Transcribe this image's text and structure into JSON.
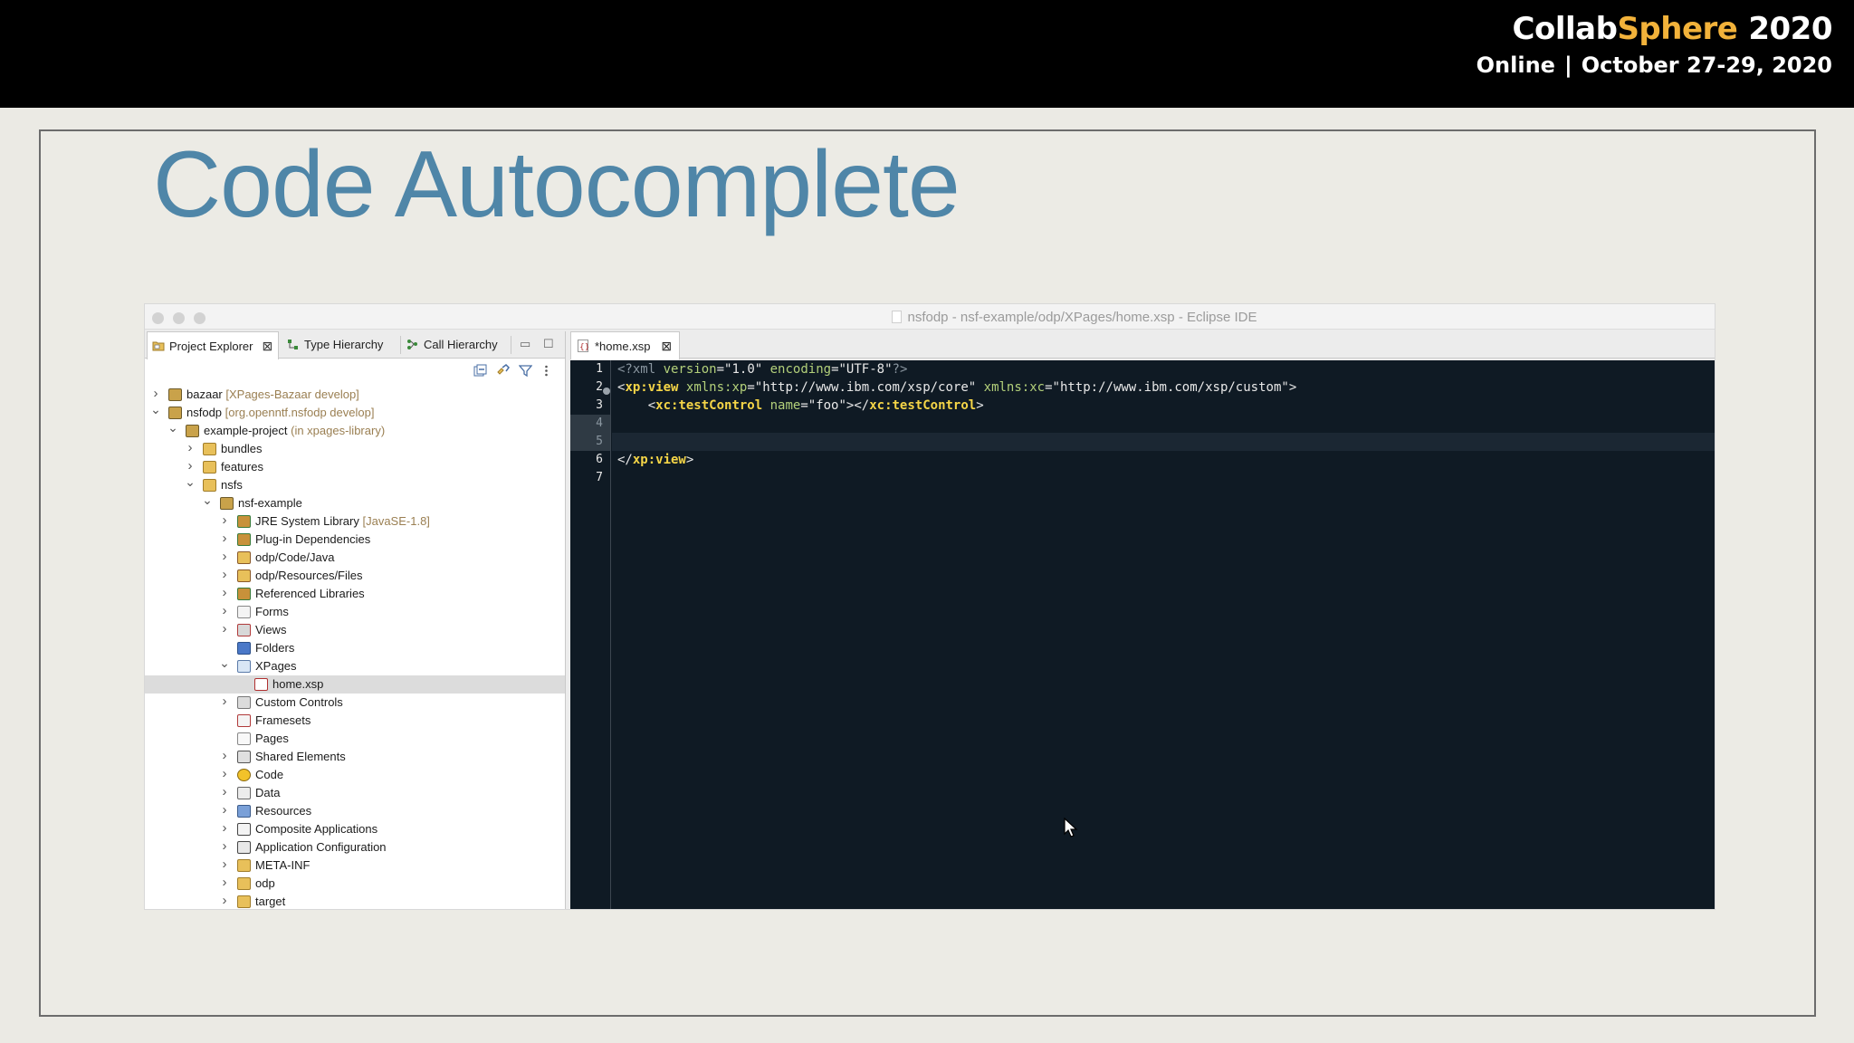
{
  "brand": {
    "collab": "Collab",
    "sphere": "Sphere",
    "year": "2020",
    "online": "Online",
    "separator": "|",
    "dates": "October 27-29, 2020"
  },
  "slide": {
    "title": "Code Autocomplete"
  },
  "window": {
    "title": "nsfodp - nsf-example/odp/XPages/home.xsp - Eclipse IDE"
  },
  "left_view": {
    "tabs": [
      {
        "label": "Project Explorer",
        "icon": "project-explorer-icon"
      },
      {
        "label": "Type Hierarchy",
        "icon": "type-hierarchy-icon"
      },
      {
        "label": "Call Hierarchy",
        "icon": "call-hierarchy-icon"
      }
    ],
    "toolbar": [
      "collapse-all-icon",
      "link-editor-icon",
      "filter-icon",
      "view-menu-icon"
    ],
    "tree": [
      {
        "label": "bazaar",
        "deco": "[XPages-Bazaar develop]",
        "level": 0,
        "expanded": false,
        "icon": "project-icon"
      },
      {
        "label": "nsfodp",
        "deco": "[org.openntf.nsfodp develop]",
        "level": 0,
        "expanded": true,
        "icon": "project-icon"
      },
      {
        "label": "example-project",
        "deco": "(in xpages-library)",
        "level": 1,
        "expanded": true,
        "icon": "project-icon"
      },
      {
        "label": "bundles",
        "deco": "",
        "level": 2,
        "expanded": false,
        "icon": "folder-icon"
      },
      {
        "label": "features",
        "deco": "",
        "level": 2,
        "expanded": false,
        "icon": "folder-icon"
      },
      {
        "label": "nsfs",
        "deco": "",
        "level": 2,
        "expanded": true,
        "icon": "folder-icon"
      },
      {
        "label": "nsf-example",
        "deco": "",
        "level": 3,
        "expanded": true,
        "icon": "project-icon"
      },
      {
        "label": "JRE System Library",
        "deco": "[JavaSE-1.8]",
        "level": 4,
        "expanded": false,
        "icon": "library-icon"
      },
      {
        "label": "Plug-in Dependencies",
        "deco": "",
        "level": 4,
        "expanded": false,
        "icon": "library-icon"
      },
      {
        "label": "odp/Code/Java",
        "deco": "",
        "level": 4,
        "expanded": false,
        "icon": "source-folder-icon"
      },
      {
        "label": "odp/Resources/Files",
        "deco": "",
        "level": 4,
        "expanded": false,
        "icon": "source-folder-icon"
      },
      {
        "label": "Referenced Libraries",
        "deco": "",
        "level": 4,
        "expanded": false,
        "icon": "library-icon"
      },
      {
        "label": "Forms",
        "deco": "",
        "level": 4,
        "expanded": false,
        "icon": "forms-icon"
      },
      {
        "label": "Views",
        "deco": "",
        "level": 4,
        "expanded": false,
        "icon": "views-icon"
      },
      {
        "label": "Folders",
        "deco": "",
        "level": 4,
        "expanded": null,
        "icon": "folders-icon"
      },
      {
        "label": "XPages",
        "deco": "",
        "level": 4,
        "expanded": true,
        "icon": "xpages-icon"
      },
      {
        "label": "home.xsp",
        "deco": "",
        "level": 5,
        "expanded": null,
        "icon": "xsp-file-icon",
        "selected": true
      },
      {
        "label": "Custom Controls",
        "deco": "",
        "level": 4,
        "expanded": false,
        "icon": "custom-controls-icon"
      },
      {
        "label": "Framesets",
        "deco": "",
        "level": 4,
        "expanded": null,
        "icon": "framesets-icon"
      },
      {
        "label": "Pages",
        "deco": "",
        "level": 4,
        "expanded": null,
        "icon": "pages-icon"
      },
      {
        "label": "Shared Elements",
        "deco": "",
        "level": 4,
        "expanded": false,
        "icon": "shared-elements-icon"
      },
      {
        "label": "Code",
        "deco": "",
        "level": 4,
        "expanded": false,
        "icon": "code-icon"
      },
      {
        "label": "Data",
        "deco": "",
        "level": 4,
        "expanded": false,
        "icon": "data-icon"
      },
      {
        "label": "Resources",
        "deco": "",
        "level": 4,
        "expanded": false,
        "icon": "resources-icon"
      },
      {
        "label": "Composite Applications",
        "deco": "",
        "level": 4,
        "expanded": false,
        "icon": "composite-apps-icon"
      },
      {
        "label": "Application Configuration",
        "deco": "",
        "level": 4,
        "expanded": false,
        "icon": "app-config-icon"
      },
      {
        "label": "META-INF",
        "deco": "",
        "level": 4,
        "expanded": false,
        "icon": "folder-icon"
      },
      {
        "label": "odp",
        "deco": "",
        "level": 4,
        "expanded": false,
        "icon": "folder-icon"
      },
      {
        "label": "target",
        "deco": "",
        "level": 4,
        "expanded": false,
        "icon": "folder-icon"
      }
    ]
  },
  "editor": {
    "tab_label": "*home.xsp",
    "line_numbers": [
      "1",
      "2",
      "3",
      "4",
      "5",
      "6",
      "7"
    ],
    "current_line": 5,
    "lines": [
      [
        [
          "c-decl",
          "<?xml "
        ],
        [
          "c-attr",
          "version"
        ],
        [
          "c-eq",
          "="
        ],
        [
          "c-str",
          "\"1.0\""
        ],
        [
          "c-decl",
          " "
        ],
        [
          "c-attr",
          "encoding"
        ],
        [
          "c-eq",
          "="
        ],
        [
          "c-str",
          "\"UTF-8\""
        ],
        [
          "c-decl",
          "?>"
        ]
      ],
      [
        [
          "c-tag",
          "<"
        ],
        [
          "c-tagname",
          "xp:view"
        ],
        [
          "c-tag",
          " "
        ],
        [
          "c-attr",
          "xmlns:xp"
        ],
        [
          "c-eq",
          "="
        ],
        [
          "c-str",
          "\"http://www.ibm.com/xsp/core\""
        ],
        [
          "c-tag",
          " "
        ],
        [
          "c-attr",
          "xmlns:xc"
        ],
        [
          "c-eq",
          "="
        ],
        [
          "c-str",
          "\"http://www.ibm.com/xsp/custom\""
        ],
        [
          "c-tag",
          ">"
        ]
      ],
      [
        [
          "c-tag",
          "    <"
        ],
        [
          "c-tagname",
          "xc:testControl"
        ],
        [
          "c-tag",
          " "
        ],
        [
          "c-attr",
          "name"
        ],
        [
          "c-eq",
          "="
        ],
        [
          "c-str",
          "\"foo\""
        ],
        [
          "c-tag",
          "></"
        ],
        [
          "c-tagname",
          "xc:testControl"
        ],
        [
          "c-tag",
          ">"
        ]
      ],
      [],
      [],
      [
        [
          "c-tag",
          "</"
        ],
        [
          "c-tagname",
          "xp:view"
        ],
        [
          "c-tag",
          ">"
        ]
      ],
      []
    ]
  },
  "colors": {
    "title": "#4f86a8",
    "brand_accent": "#f2b23a",
    "editor_bg": "#0f1a24"
  }
}
